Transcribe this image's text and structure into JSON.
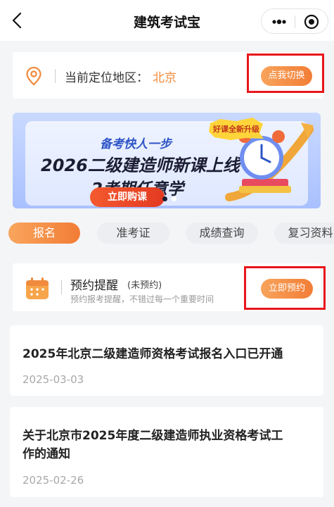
{
  "nav": {
    "title": "建筑考试宝"
  },
  "location": {
    "label": "当前定位地区：",
    "city": "北京",
    "switch_button": "点我切换"
  },
  "banner": {
    "tagline": "备考快人一步",
    "headline_line1": "2026二级建造师新课上线",
    "headline_line2": "2考期任意学",
    "badge": "好课全新升级",
    "buy_button": "立即购课",
    "page_count": 2,
    "active_page": 1
  },
  "tabs": [
    {
      "label": "报名",
      "active": true
    },
    {
      "label": "准考证",
      "active": false
    },
    {
      "label": "成绩查询",
      "active": false
    },
    {
      "label": "复习资料",
      "active": false
    }
  ],
  "reminder": {
    "title": "预约提醒",
    "status": "(未预约)",
    "subtitle": "预约报考提醒，不错过每一个重要时间",
    "button": "立即预约"
  },
  "news": [
    {
      "title": "2025年北京二级建造师资格考试报名入口已开通",
      "date": "2025-03-03"
    },
    {
      "title_line1": "关于北京市2025年度二级建造师执业资格考试工",
      "title_line2": "作的通知",
      "date": "2025-02-26"
    }
  ],
  "colors": {
    "accent": "#f27d36",
    "highlight": "#e8161c",
    "city": "#f08a3c",
    "banner_blue": "#2e55c7"
  },
  "icons": [
    "back-arrow-icon",
    "more-dots-icon",
    "target-circle-icon",
    "location-pin-icon",
    "calendar-icon",
    "alarm-clock-icon"
  ]
}
